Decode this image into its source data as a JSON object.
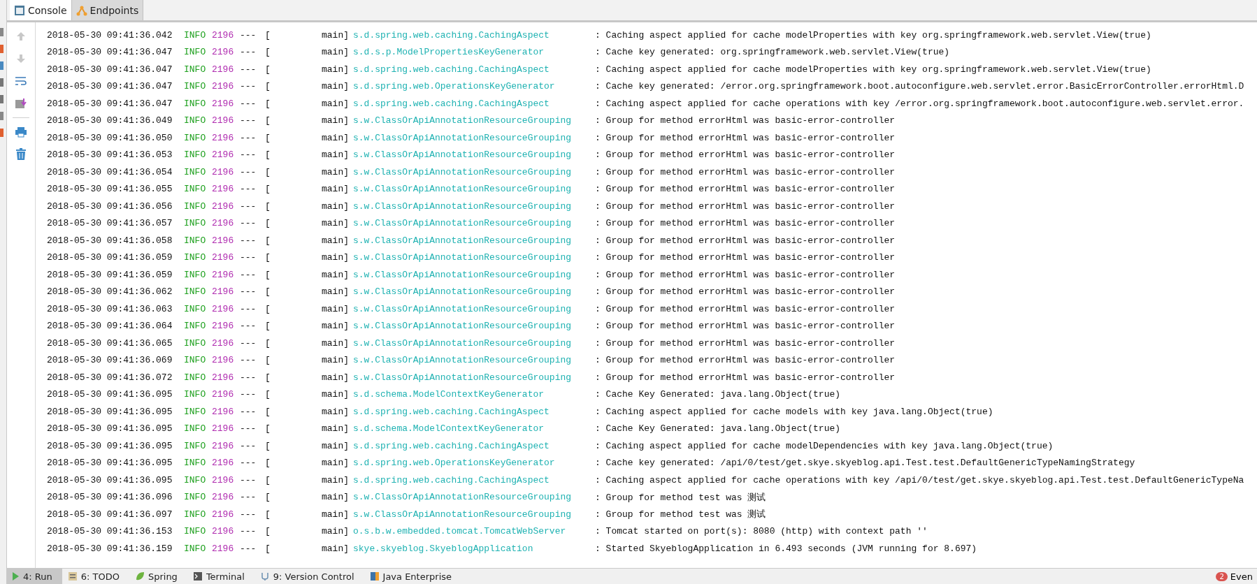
{
  "tool_tabs": [
    {
      "label": "Console",
      "selected": true
    },
    {
      "label": "Endpoints",
      "selected": false
    }
  ],
  "log": [
    {
      "time": "2018-05-30 09:41:36.042",
      "level": "INFO",
      "pid": "2196",
      "sep": "---",
      "open": "[",
      "thread": "main]",
      "logger": "s.d.spring.web.caching.CachingAspect",
      "message": ": Caching aspect applied for cache modelProperties with key org.springframework.web.servlet.View(true)"
    },
    {
      "time": "2018-05-30 09:41:36.047",
      "level": "INFO",
      "pid": "2196",
      "sep": "---",
      "open": "[",
      "thread": "main]",
      "logger": "s.d.s.p.ModelPropertiesKeyGenerator",
      "message": ": Cache key generated: org.springframework.web.servlet.View(true)"
    },
    {
      "time": "2018-05-30 09:41:36.047",
      "level": "INFO",
      "pid": "2196",
      "sep": "---",
      "open": "[",
      "thread": "main]",
      "logger": "s.d.spring.web.caching.CachingAspect",
      "message": ": Caching aspect applied for cache modelProperties with key org.springframework.web.servlet.View(true)"
    },
    {
      "time": "2018-05-30 09:41:36.047",
      "level": "INFO",
      "pid": "2196",
      "sep": "---",
      "open": "[",
      "thread": "main]",
      "logger": "s.d.spring.web.OperationsKeyGenerator",
      "message": ": Cache key generated: /error.org.springframework.boot.autoconfigure.web.servlet.error.BasicErrorController.errorHtml.D"
    },
    {
      "time": "2018-05-30 09:41:36.047",
      "level": "INFO",
      "pid": "2196",
      "sep": "---",
      "open": "[",
      "thread": "main]",
      "logger": "s.d.spring.web.caching.CachingAspect",
      "message": ": Caching aspect applied for cache operations with key /error.org.springframework.boot.autoconfigure.web.servlet.error."
    },
    {
      "time": "2018-05-30 09:41:36.049",
      "level": "INFO",
      "pid": "2196",
      "sep": "---",
      "open": "[",
      "thread": "main]",
      "logger": "s.w.ClassOrApiAnnotationResourceGrouping",
      "message": ": Group for method errorHtml was basic-error-controller"
    },
    {
      "time": "2018-05-30 09:41:36.050",
      "level": "INFO",
      "pid": "2196",
      "sep": "---",
      "open": "[",
      "thread": "main]",
      "logger": "s.w.ClassOrApiAnnotationResourceGrouping",
      "message": ": Group for method errorHtml was basic-error-controller"
    },
    {
      "time": "2018-05-30 09:41:36.053",
      "level": "INFO",
      "pid": "2196",
      "sep": "---",
      "open": "[",
      "thread": "main]",
      "logger": "s.w.ClassOrApiAnnotationResourceGrouping",
      "message": ": Group for method errorHtml was basic-error-controller"
    },
    {
      "time": "2018-05-30 09:41:36.054",
      "level": "INFO",
      "pid": "2196",
      "sep": "---",
      "open": "[",
      "thread": "main]",
      "logger": "s.w.ClassOrApiAnnotationResourceGrouping",
      "message": ": Group for method errorHtml was basic-error-controller"
    },
    {
      "time": "2018-05-30 09:41:36.055",
      "level": "INFO",
      "pid": "2196",
      "sep": "---",
      "open": "[",
      "thread": "main]",
      "logger": "s.w.ClassOrApiAnnotationResourceGrouping",
      "message": ": Group for method errorHtml was basic-error-controller"
    },
    {
      "time": "2018-05-30 09:41:36.056",
      "level": "INFO",
      "pid": "2196",
      "sep": "---",
      "open": "[",
      "thread": "main]",
      "logger": "s.w.ClassOrApiAnnotationResourceGrouping",
      "message": ": Group for method errorHtml was basic-error-controller"
    },
    {
      "time": "2018-05-30 09:41:36.057",
      "level": "INFO",
      "pid": "2196",
      "sep": "---",
      "open": "[",
      "thread": "main]",
      "logger": "s.w.ClassOrApiAnnotationResourceGrouping",
      "message": ": Group for method errorHtml was basic-error-controller"
    },
    {
      "time": "2018-05-30 09:41:36.058",
      "level": "INFO",
      "pid": "2196",
      "sep": "---",
      "open": "[",
      "thread": "main]",
      "logger": "s.w.ClassOrApiAnnotationResourceGrouping",
      "message": ": Group for method errorHtml was basic-error-controller"
    },
    {
      "time": "2018-05-30 09:41:36.059",
      "level": "INFO",
      "pid": "2196",
      "sep": "---",
      "open": "[",
      "thread": "main]",
      "logger": "s.w.ClassOrApiAnnotationResourceGrouping",
      "message": ": Group for method errorHtml was basic-error-controller"
    },
    {
      "time": "2018-05-30 09:41:36.059",
      "level": "INFO",
      "pid": "2196",
      "sep": "---",
      "open": "[",
      "thread": "main]",
      "logger": "s.w.ClassOrApiAnnotationResourceGrouping",
      "message": ": Group for method errorHtml was basic-error-controller"
    },
    {
      "time": "2018-05-30 09:41:36.062",
      "level": "INFO",
      "pid": "2196",
      "sep": "---",
      "open": "[",
      "thread": "main]",
      "logger": "s.w.ClassOrApiAnnotationResourceGrouping",
      "message": ": Group for method errorHtml was basic-error-controller"
    },
    {
      "time": "2018-05-30 09:41:36.063",
      "level": "INFO",
      "pid": "2196",
      "sep": "---",
      "open": "[",
      "thread": "main]",
      "logger": "s.w.ClassOrApiAnnotationResourceGrouping",
      "message": ": Group for method errorHtml was basic-error-controller"
    },
    {
      "time": "2018-05-30 09:41:36.064",
      "level": "INFO",
      "pid": "2196",
      "sep": "---",
      "open": "[",
      "thread": "main]",
      "logger": "s.w.ClassOrApiAnnotationResourceGrouping",
      "message": ": Group for method errorHtml was basic-error-controller"
    },
    {
      "time": "2018-05-30 09:41:36.065",
      "level": "INFO",
      "pid": "2196",
      "sep": "---",
      "open": "[",
      "thread": "main]",
      "logger": "s.w.ClassOrApiAnnotationResourceGrouping",
      "message": ": Group for method errorHtml was basic-error-controller"
    },
    {
      "time": "2018-05-30 09:41:36.069",
      "level": "INFO",
      "pid": "2196",
      "sep": "---",
      "open": "[",
      "thread": "main]",
      "logger": "s.w.ClassOrApiAnnotationResourceGrouping",
      "message": ": Group for method errorHtml was basic-error-controller"
    },
    {
      "time": "2018-05-30 09:41:36.072",
      "level": "INFO",
      "pid": "2196",
      "sep": "---",
      "open": "[",
      "thread": "main]",
      "logger": "s.w.ClassOrApiAnnotationResourceGrouping",
      "message": ": Group for method errorHtml was basic-error-controller"
    },
    {
      "time": "2018-05-30 09:41:36.095",
      "level": "INFO",
      "pid": "2196",
      "sep": "---",
      "open": "[",
      "thread": "main]",
      "logger": "s.d.schema.ModelContextKeyGenerator",
      "message": ": Cache Key Generated: java.lang.Object(true)"
    },
    {
      "time": "2018-05-30 09:41:36.095",
      "level": "INFO",
      "pid": "2196",
      "sep": "---",
      "open": "[",
      "thread": "main]",
      "logger": "s.d.spring.web.caching.CachingAspect",
      "message": ": Caching aspect applied for cache models with key java.lang.Object(true)"
    },
    {
      "time": "2018-05-30 09:41:36.095",
      "level": "INFO",
      "pid": "2196",
      "sep": "---",
      "open": "[",
      "thread": "main]",
      "logger": "s.d.schema.ModelContextKeyGenerator",
      "message": ": Cache Key Generated: java.lang.Object(true)"
    },
    {
      "time": "2018-05-30 09:41:36.095",
      "level": "INFO",
      "pid": "2196",
      "sep": "---",
      "open": "[",
      "thread": "main]",
      "logger": "s.d.spring.web.caching.CachingAspect",
      "message": ": Caching aspect applied for cache modelDependencies with key java.lang.Object(true)"
    },
    {
      "time": "2018-05-30 09:41:36.095",
      "level": "INFO",
      "pid": "2196",
      "sep": "---",
      "open": "[",
      "thread": "main]",
      "logger": "s.d.spring.web.OperationsKeyGenerator",
      "message": ": Cache key generated: /api/0/test/get.skye.skyeblog.api.Test.test.DefaultGenericTypeNamingStrategy"
    },
    {
      "time": "2018-05-30 09:41:36.095",
      "level": "INFO",
      "pid": "2196",
      "sep": "---",
      "open": "[",
      "thread": "main]",
      "logger": "s.d.spring.web.caching.CachingAspect",
      "message": ": Caching aspect applied for cache operations with key /api/0/test/get.skye.skyeblog.api.Test.test.DefaultGenericTypeNa"
    },
    {
      "time": "2018-05-30 09:41:36.096",
      "level": "INFO",
      "pid": "2196",
      "sep": "---",
      "open": "[",
      "thread": "main]",
      "logger": "s.w.ClassOrApiAnnotationResourceGrouping",
      "message": ": Group for method test was 测试"
    },
    {
      "time": "2018-05-30 09:41:36.097",
      "level": "INFO",
      "pid": "2196",
      "sep": "---",
      "open": "[",
      "thread": "main]",
      "logger": "s.w.ClassOrApiAnnotationResourceGrouping",
      "message": ": Group for method test was 测试"
    },
    {
      "time": "2018-05-30 09:41:36.153",
      "level": "INFO",
      "pid": "2196",
      "sep": "---",
      "open": "[",
      "thread": "main]",
      "logger": "o.s.b.w.embedded.tomcat.TomcatWebServer",
      "message": ": Tomcat started on port(s): 8080 (http) with context path ''"
    },
    {
      "time": "2018-05-30 09:41:36.159",
      "level": "INFO",
      "pid": "2196",
      "sep": "---",
      "open": "[",
      "thread": "main]",
      "logger": "skye.skyeblog.SkyeblogApplication",
      "message": ": Started SkyeblogApplication in 6.493 seconds (JVM running for 8.697)"
    }
  ],
  "bottom_tabs": [
    {
      "label": "4: Run",
      "selected": true
    },
    {
      "label": "6: TODO",
      "selected": false
    },
    {
      "label": "Spring",
      "selected": false
    },
    {
      "label": "Terminal",
      "selected": false
    },
    {
      "label": "9: Version Control",
      "selected": false
    },
    {
      "label": "Java Enterprise",
      "selected": false
    }
  ],
  "event_log": {
    "badge": "2",
    "label": "Even"
  }
}
